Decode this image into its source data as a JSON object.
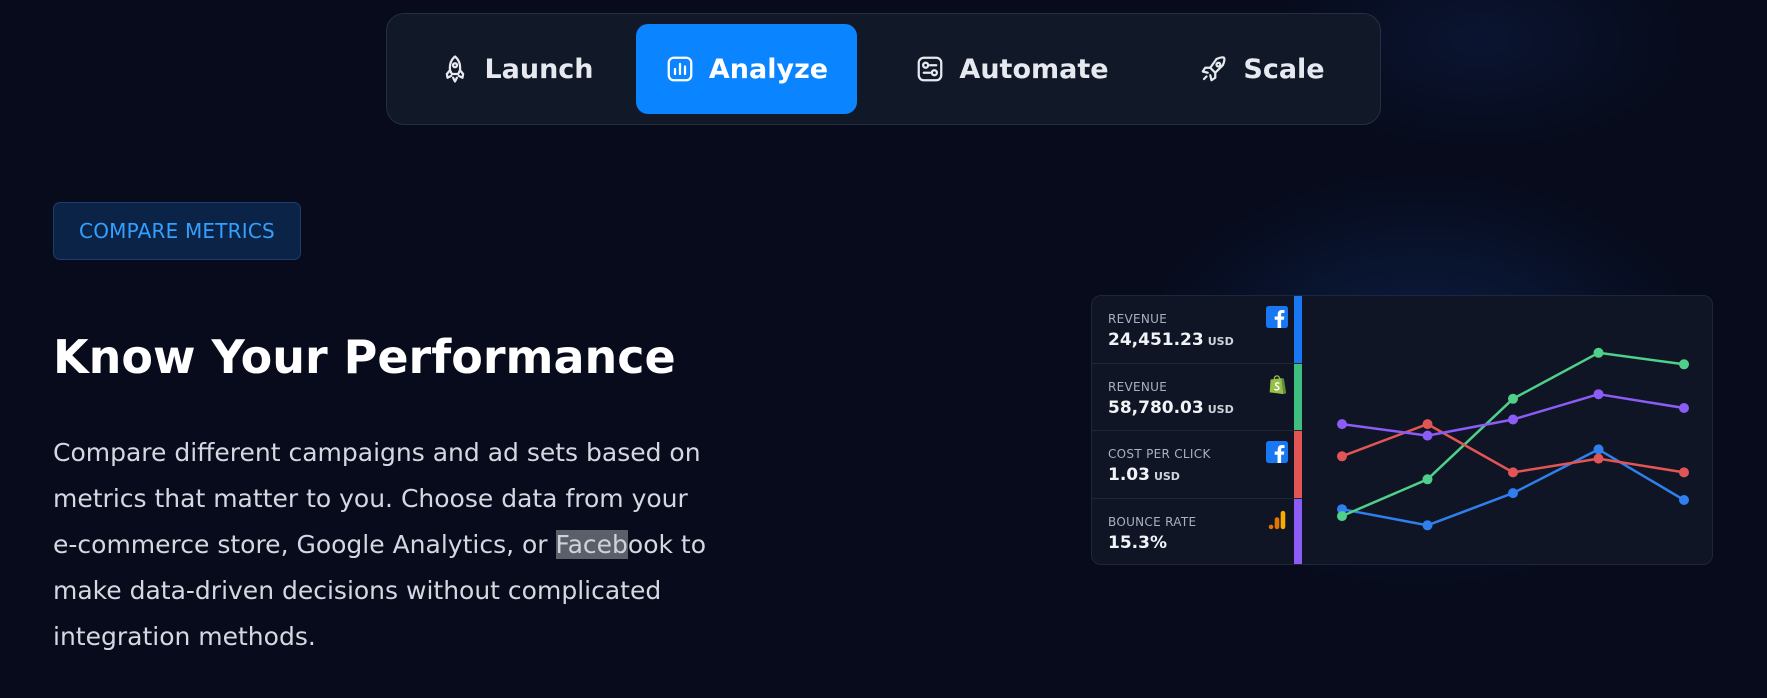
{
  "tabs": [
    {
      "label": "Launch",
      "icon": "rocket-outline-icon",
      "active": false
    },
    {
      "label": "Analyze",
      "icon": "bar-chart-icon",
      "active": true
    },
    {
      "label": "Automate",
      "icon": "toggle-settings-icon",
      "active": false
    },
    {
      "label": "Scale",
      "icon": "rocket-icon",
      "active": false
    }
  ],
  "badge": "COMPARE METRICS",
  "heading": "Know Your Performance",
  "description": {
    "before": "Compare different campaigns and ad sets based on metrics that matter to you. Choose data from your e-commerce store, Google Analytics, or ",
    "highlight": "Faceb",
    "after": "ook to make data-driven decisions without complicated integration methods."
  },
  "metrics": [
    {
      "label": "REVENUE",
      "value": "24,451.23",
      "unit": "USD",
      "source_icon": "facebook-icon",
      "color": "#1877f2"
    },
    {
      "label": "REVENUE",
      "value": "58,780.03",
      "unit": "USD",
      "source_icon": "shopify-icon",
      "color": "#3fbf7f"
    },
    {
      "label": "COST PER CLICK",
      "value": "1.03",
      "unit": "USD",
      "source_icon": "facebook-icon",
      "color": "#e25555"
    },
    {
      "label": "BOUNCE RATE",
      "value": "15.3%",
      "unit": "",
      "source_icon": "google-analytics-icon",
      "color": "#8b5cf6"
    }
  ],
  "chart_data": {
    "type": "line",
    "x": [
      1,
      2,
      3,
      4,
      5
    ],
    "series": [
      {
        "values": [
          1.6,
          0.9,
          2.3,
          4.2,
          2.0
        ],
        "color": "#2f7fef"
      },
      {
        "values": [
          1.3,
          2.9,
          6.4,
          8.4,
          7.9
        ],
        "color": "#4fcf8a"
      },
      {
        "values": [
          3.9,
          5.3,
          3.2,
          3.8,
          3.2
        ],
        "color": "#e25555"
      },
      {
        "values": [
          5.3,
          4.8,
          5.5,
          6.6,
          6.0
        ],
        "color": "#8b5cf6"
      }
    ],
    "ylim": [
      0,
      10
    ],
    "grid": false
  }
}
